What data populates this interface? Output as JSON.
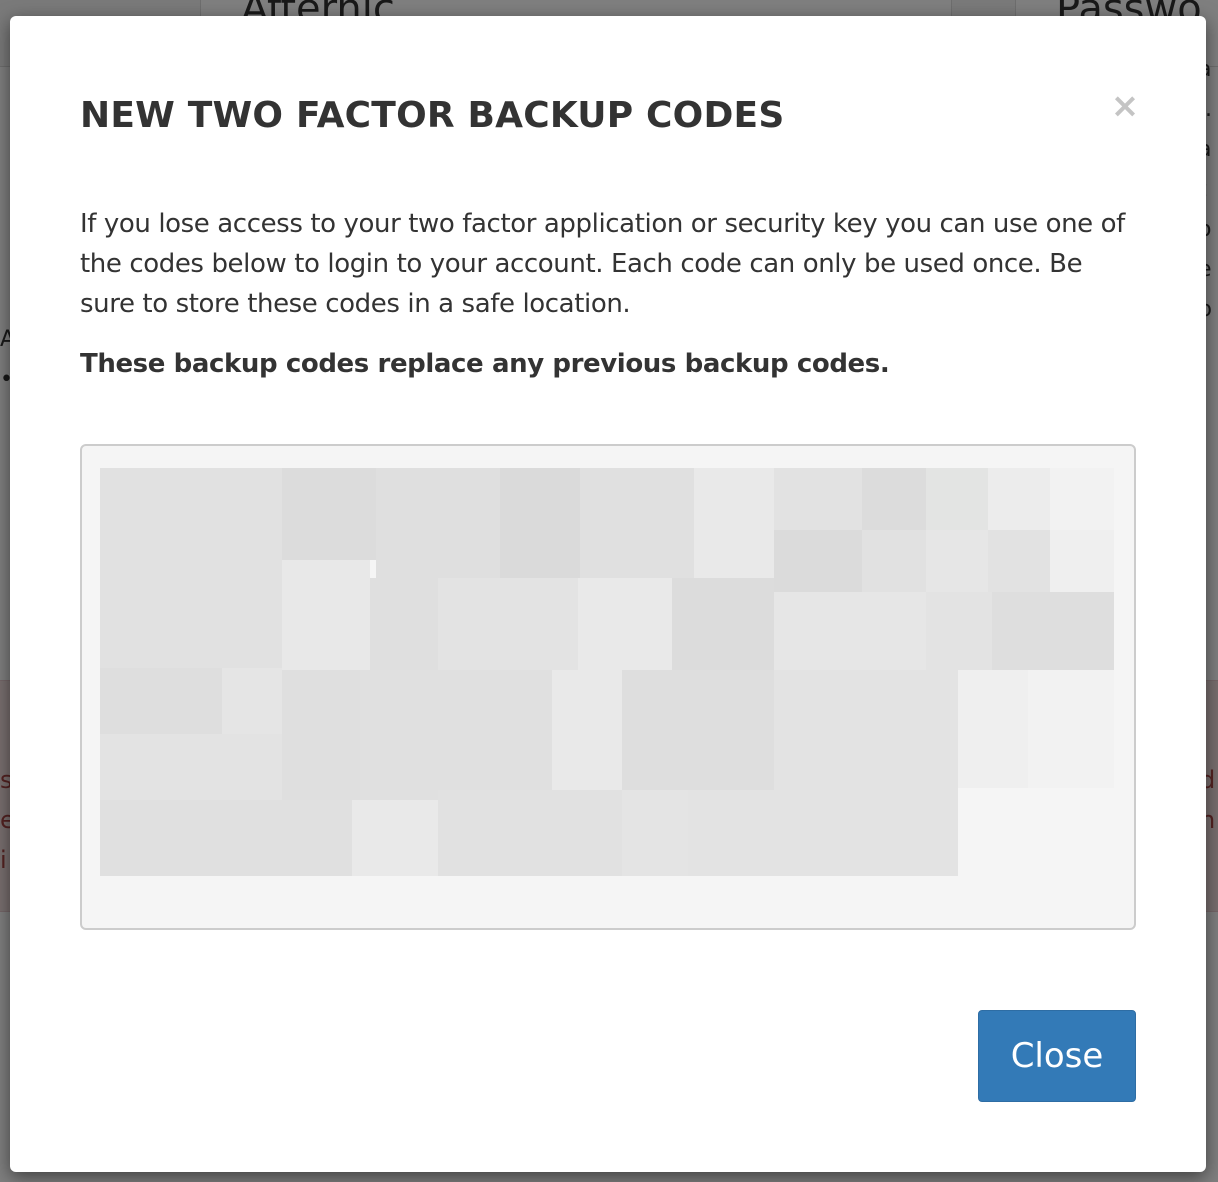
{
  "background": {
    "tabs": [
      "Afternic",
      "Passwo"
    ],
    "right_edge_text": [
      "a",
      "..",
      "a",
      "t",
      "o",
      "e",
      "p"
    ],
    "left_edge_text": [
      "A",
      "•"
    ],
    "alert_left_text": [
      "s",
      "e",
      "i"
    ],
    "alert_right_text": [
      "d",
      "n"
    ]
  },
  "modal": {
    "title": "NEW TWO FACTOR BACKUP CODES",
    "close_icon": "×",
    "description": "If you lose access to your two factor application or security key you can use one of the codes below to login to your account. Each code can only be used once. Be sure to store these codes in a safe location.",
    "warning": "These backup codes replace any previous backup codes.",
    "codes_redacted": true,
    "close_label": "Close"
  },
  "colors": {
    "primary_button": "#337ab7",
    "title_text": "#333333",
    "codes_background": "#f5f5f5",
    "alert_background": "#f2dede",
    "alert_text": "#a94442"
  }
}
